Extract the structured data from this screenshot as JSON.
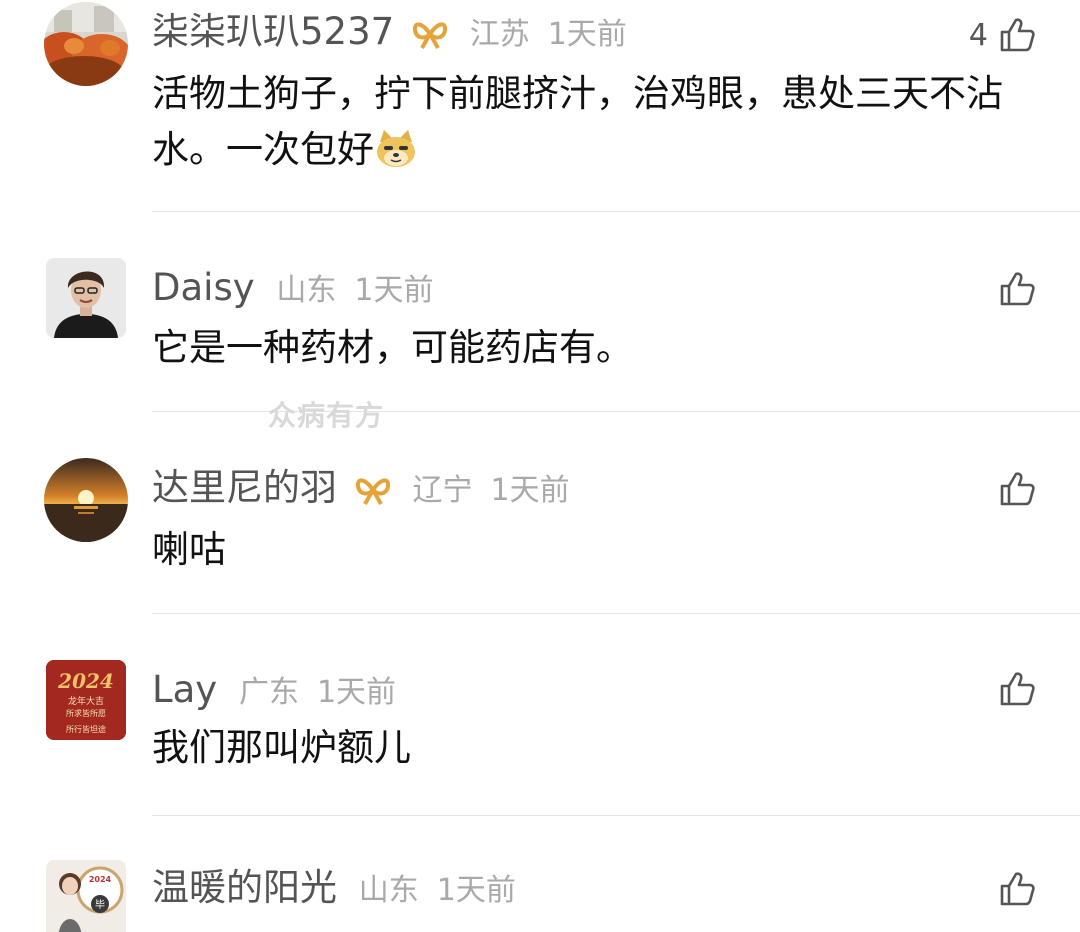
{
  "watermark": "众病有方",
  "comments": [
    {
      "name": "柒柒玐玐5237",
      "has_badge": true,
      "location": "江苏",
      "time": "1天前",
      "like_count": "4",
      "text": "活物土狗子，拧下前腿挤汁，治鸡眼，患处三天不沾水。一次包好"
    },
    {
      "name": "Daisy",
      "has_badge": false,
      "location": "山东",
      "time": "1天前",
      "like_count": "",
      "text": "它是一种药材，可能药店有。"
    },
    {
      "name": "达里尼的羽",
      "has_badge": true,
      "location": "辽宁",
      "time": "1天前",
      "like_count": "",
      "text": "喇咕"
    },
    {
      "name": "Lay",
      "has_badge": false,
      "location": "广东",
      "time": "1天前",
      "like_count": "",
      "text": "我们那叫炉额儿"
    },
    {
      "name": "温暖的阳光",
      "has_badge": false,
      "location": "山东",
      "time": "1天前",
      "like_count": "",
      "text": ""
    }
  ],
  "avatar_texts": {
    "year": "2024",
    "lay_line1": "龙年大吉",
    "lay_line2": "所求皆所愿",
    "lay_line3": "所行皆坦途",
    "sun_badge": "毕"
  },
  "icons": {
    "like": "thumbs-up-icon",
    "badge": "gold-ribbon-badge-icon",
    "emoji": "doge-emoji-icon"
  }
}
